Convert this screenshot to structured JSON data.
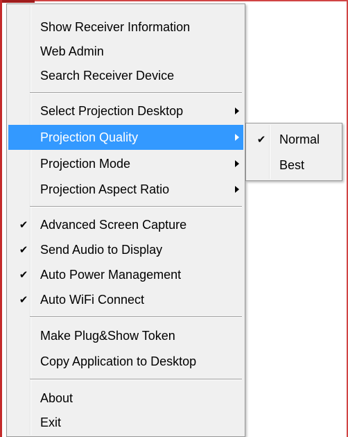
{
  "menu": {
    "items": [
      {
        "label": "Show Receiver Information"
      },
      {
        "label": "Web Admin"
      },
      {
        "label": "Search Receiver Device"
      },
      {
        "label": "Select Projection Desktop"
      },
      {
        "label": "Projection Quality"
      },
      {
        "label": "Projection Mode"
      },
      {
        "label": "Projection Aspect Ratio"
      },
      {
        "label": "Advanced Screen Capture",
        "checked": true
      },
      {
        "label": "Send Audio to Display",
        "checked": true
      },
      {
        "label": "Auto Power Management",
        "checked": true
      },
      {
        "label": "Auto WiFi Connect",
        "checked": true
      },
      {
        "label": "Make Plug&Show Token"
      },
      {
        "label": "Copy Application to Desktop"
      },
      {
        "label": "About"
      },
      {
        "label": "Exit"
      }
    ],
    "highlighted": "Projection Quality"
  },
  "submenu": {
    "items": [
      {
        "label": "Normal",
        "checked": true
      },
      {
        "label": "Best",
        "checked": false
      }
    ]
  },
  "check_glyph": "✔",
  "colors": {
    "highlight": "#3399ff",
    "menu_bg": "#f0f0f0",
    "window_border": "#d04545"
  }
}
